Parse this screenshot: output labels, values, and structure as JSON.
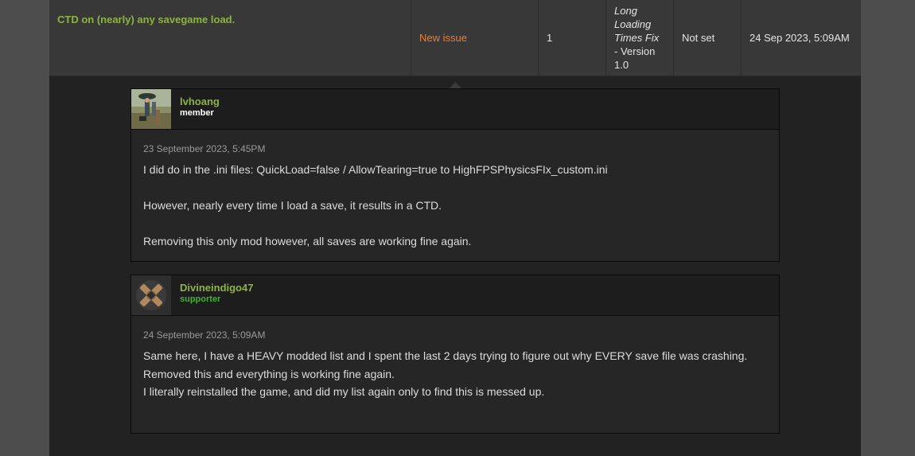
{
  "issue": {
    "title": "CTD on (nearly) any savegame load.",
    "status": "New issue",
    "replies": "1",
    "version_name": "Long Loading Times Fix",
    "version_suffix": "- Version 1.0",
    "priority": "Not set",
    "last_post": "24 Sep 2023, 5:09AM"
  },
  "colors": {
    "accent_green": "#8db43e",
    "status_orange": "#ec7f35",
    "supporter_green": "#45b02c"
  },
  "comments": [
    {
      "author": "lvhoang",
      "role": "member",
      "date": "23 September 2023, 5:45PM",
      "lines": [
        "I did do in the .ini files: QuickLoad=false / AllowTearing=true to HighFPSPhysicsFIx_custom.ini",
        "However, nearly every time I load a save, it results in a CTD.",
        "Removing this only mod however, all saves are working fine again."
      ]
    },
    {
      "author": "Divineindigo47",
      "role": "supporter",
      "date": "24 September 2023, 5:09AM",
      "lines": [
        "Same here, I have a HEAVY modded list and I spent the last 2 days trying to figure out why EVERY save file was crashing. Removed this and everything is working fine again.",
        "I literally reinstalled the game, and did my list again only to find this is messed up."
      ]
    }
  ]
}
